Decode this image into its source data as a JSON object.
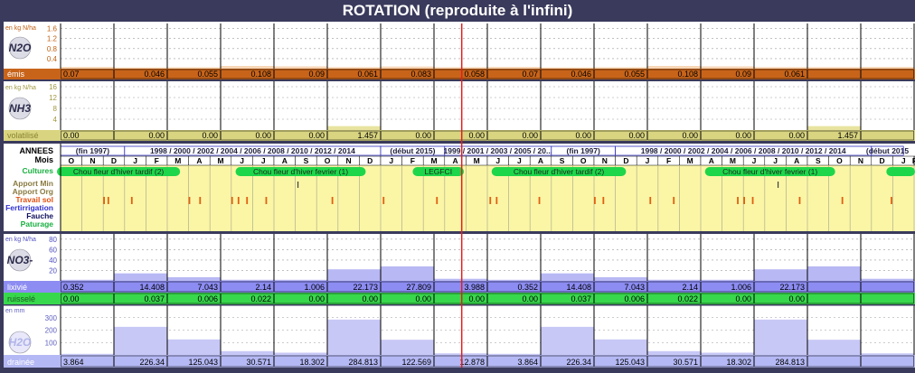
{
  "title": "ROTATION (reproduite à l'infini)",
  "colors": {
    "frame": "#3a3a5c",
    "n2o_row": "#c8641a",
    "n2o_bar": "#f7d6b6",
    "nh3_row": "#d8d480",
    "nh3_bar": "#e8e4a0",
    "calendar": "#fbf6a6",
    "crop": "#1ed64a",
    "no3_row": "#8c8cf2",
    "no3_bar": "#b8b8f4",
    "runoff_row": "#38d84c",
    "h2o_row": "#b4b8f4",
    "h2o_bar": "#c8c8f6",
    "marker": "#e02020"
  },
  "panels": {
    "n2o": {
      "unit": "en kg N/ha",
      "ticks": [
        "1.6",
        "1.2",
        "0.8",
        "0.4"
      ],
      "ymax": 1.8,
      "icon": "N2O",
      "row_label": "émis"
    },
    "nh3": {
      "unit": "en kg N/ha",
      "ticks": [
        "16",
        "12",
        "8",
        "4"
      ],
      "ymax": 18,
      "icon": "NH3",
      "row_label": "volatilisé"
    },
    "no3": {
      "unit": "en kg N/ha",
      "ticks": [
        "80",
        "60",
        "40",
        "20"
      ],
      "ymax": 90,
      "icon": "NO3-",
      "row_label": "lixivié",
      "row2_label": "ruisselé"
    },
    "h2o": {
      "unit": "en mm",
      "ticks": [
        "300",
        "200",
        "100"
      ],
      "ymax": 400,
      "icon": "H2O",
      "row_label": "drainée"
    }
  },
  "calendar": {
    "labels": [
      "ANNEES",
      "Mois",
      "Cultures",
      "Apport Min",
      "Apport Org",
      "Travail sol",
      "Fertirrigation",
      "Fauche",
      "Paturage"
    ],
    "label_colors": [
      "#000000",
      "#000000",
      "#18b040",
      "#8a7a40",
      "#8a7a40",
      "#e05010",
      "#3030d0",
      "#101060",
      "#18b040"
    ],
    "years": [
      {
        "text": "(fin 1997)",
        "start": 0,
        "end": 3
      },
      {
        "text": "1998 / 2000 / 2002 / 2004 / 2006 / 2008 / 2010 / 2012 / 2014",
        "start": 3,
        "end": 15
      },
      {
        "text": "(début 2015)",
        "start": 15,
        "end": 18
      },
      {
        "text": "1999 / 2001 / 2003 / 2005 / 20...",
        "start": 18,
        "end": 23
      },
      {
        "text": "(fin 1997)",
        "start": 23,
        "end": 26
      },
      {
        "text": "1998 / 2000 / 2002 / 2004 / 2006 / 2008 / 2010 / 2012 / 2014",
        "start": 26,
        "end": 38
      },
      {
        "text": "(début 2015",
        "start": 38,
        "end": 39.5
      }
    ],
    "months": [
      "O",
      "N",
      "D",
      "J",
      "F",
      "M",
      "A",
      "M",
      "J",
      "J",
      "A",
      "S",
      "O",
      "N",
      "D",
      "J",
      "F",
      "M",
      "A",
      "M",
      "J",
      "J",
      "A",
      "S",
      "O",
      "N",
      "D",
      "J",
      "F",
      "M",
      "A",
      "M",
      "J",
      "J",
      "A",
      "S",
      "O",
      "N",
      "D",
      "J",
      "F"
    ],
    "crops": [
      {
        "text": "Chou fleur d'hiver tardif (2)",
        "start": -0.3,
        "end": 5.6
      },
      {
        "text": "Chou fleur d'hiver fevrier (1)",
        "start": 8.2,
        "end": 14.3
      },
      {
        "text": "LEGFCI",
        "start": 16.5,
        "end": 18.9
      },
      {
        "text": "Chou fleur d'hiver tardif (2)",
        "start": 20.2,
        "end": 26.5
      },
      {
        "text": "Chou fleur d'hiver fevrier (1)",
        "start": 30.2,
        "end": 36.3
      },
      {
        "text": "",
        "start": 38.7,
        "end": 40.2
      }
    ]
  },
  "chart_data": {
    "type": "bar",
    "x_unit": "month",
    "periods": [
      {
        "start": 0,
        "end": 2.5
      },
      {
        "start": 2.5,
        "end": 5
      },
      {
        "start": 5,
        "end": 7.5
      },
      {
        "start": 7.5,
        "end": 10
      },
      {
        "start": 10,
        "end": 12.5
      },
      {
        "start": 12.5,
        "end": 15
      },
      {
        "start": 15,
        "end": 17.5
      },
      {
        "start": 17.5,
        "end": 20
      },
      {
        "start": 20,
        "end": 22.5
      },
      {
        "start": 22.5,
        "end": 25
      },
      {
        "start": 25,
        "end": 27.5
      },
      {
        "start": 27.5,
        "end": 30
      },
      {
        "start": 30,
        "end": 32.5
      },
      {
        "start": 32.5,
        "end": 35
      },
      {
        "start": 35,
        "end": 37.5
      },
      {
        "start": 37.5,
        "end": 40
      }
    ],
    "marker_month": 18.8,
    "series": [
      {
        "name": "émis",
        "values": [
          0.07,
          0.046,
          0.055,
          0.108,
          0.09,
          0.061,
          0.083,
          0.058,
          0.07,
          0.046,
          0.055,
          0.108,
          0.09,
          0.061,
          "",
          ""
        ]
      },
      {
        "name": "volatilisé",
        "values": [
          "0.00",
          "0.00",
          "0.00",
          "0.00",
          "0.00",
          "1.457",
          "0.00",
          "0.00",
          "0.00",
          "0.00",
          "0.00",
          "0.00",
          "0.00",
          "0.00",
          "1.457",
          ""
        ]
      },
      {
        "name": "lixivié",
        "values": [
          0.352,
          14.408,
          7.043,
          2.14,
          1.006,
          22.173,
          27.809,
          3.988,
          0.352,
          14.408,
          7.043,
          2.14,
          1.006,
          22.173,
          "",
          ""
        ]
      },
      {
        "name": "ruisselé",
        "values": [
          "0.00",
          0.037,
          0.006,
          0.022,
          "0.00",
          "0.00",
          "0.00",
          "0.00",
          "0.00",
          0.037,
          0.006,
          0.022,
          "0.00",
          "0.00",
          "",
          ""
        ]
      },
      {
        "name": "drainée",
        "values": [
          3.864,
          226.34,
          125.043,
          30.571,
          18.302,
          284.813,
          122.569,
          12.878,
          3.864,
          226.34,
          125.043,
          30.571,
          18.302,
          284.813,
          "",
          ""
        ]
      }
    ],
    "bar_fill_values": {
      "n2o": [
        0.07,
        0.046,
        0.055,
        0.108,
        0.09,
        0.061,
        0.083,
        0.058,
        0.07,
        0.046,
        0.055,
        0.108,
        0.09,
        0.061,
        0.061,
        0.07
      ],
      "nh3": [
        0,
        0,
        0,
        0,
        0,
        1.457,
        0,
        0,
        0,
        0,
        0,
        0,
        0,
        0,
        1.457,
        0
      ],
      "no3": [
        0.352,
        14.408,
        7.043,
        2.14,
        1.006,
        22.173,
        27.809,
        3.988,
        0.352,
        14.408,
        7.043,
        2.14,
        1.006,
        22.173,
        27.809,
        3.988
      ],
      "h2o": [
        3.864,
        226.34,
        125.043,
        30.571,
        18.302,
        284.813,
        122.569,
        12.878,
        3.864,
        226.34,
        125.043,
        30.571,
        18.302,
        284.813,
        122.569,
        12.878
      ]
    },
    "operations": {
      "apport_min": [
        11.1,
        33.6
      ],
      "travail_sol": [
        2.0,
        2.2,
        3.3,
        6.0,
        6.5,
        8.0,
        8.3,
        8.7,
        9.6,
        12.7,
        15.1,
        17.6,
        20.1,
        20.4,
        22.4,
        25.0,
        25.4,
        27.6,
        28.7,
        31.7,
        32.0,
        32.4,
        34.6,
        36.6,
        38.9
      ]
    }
  }
}
